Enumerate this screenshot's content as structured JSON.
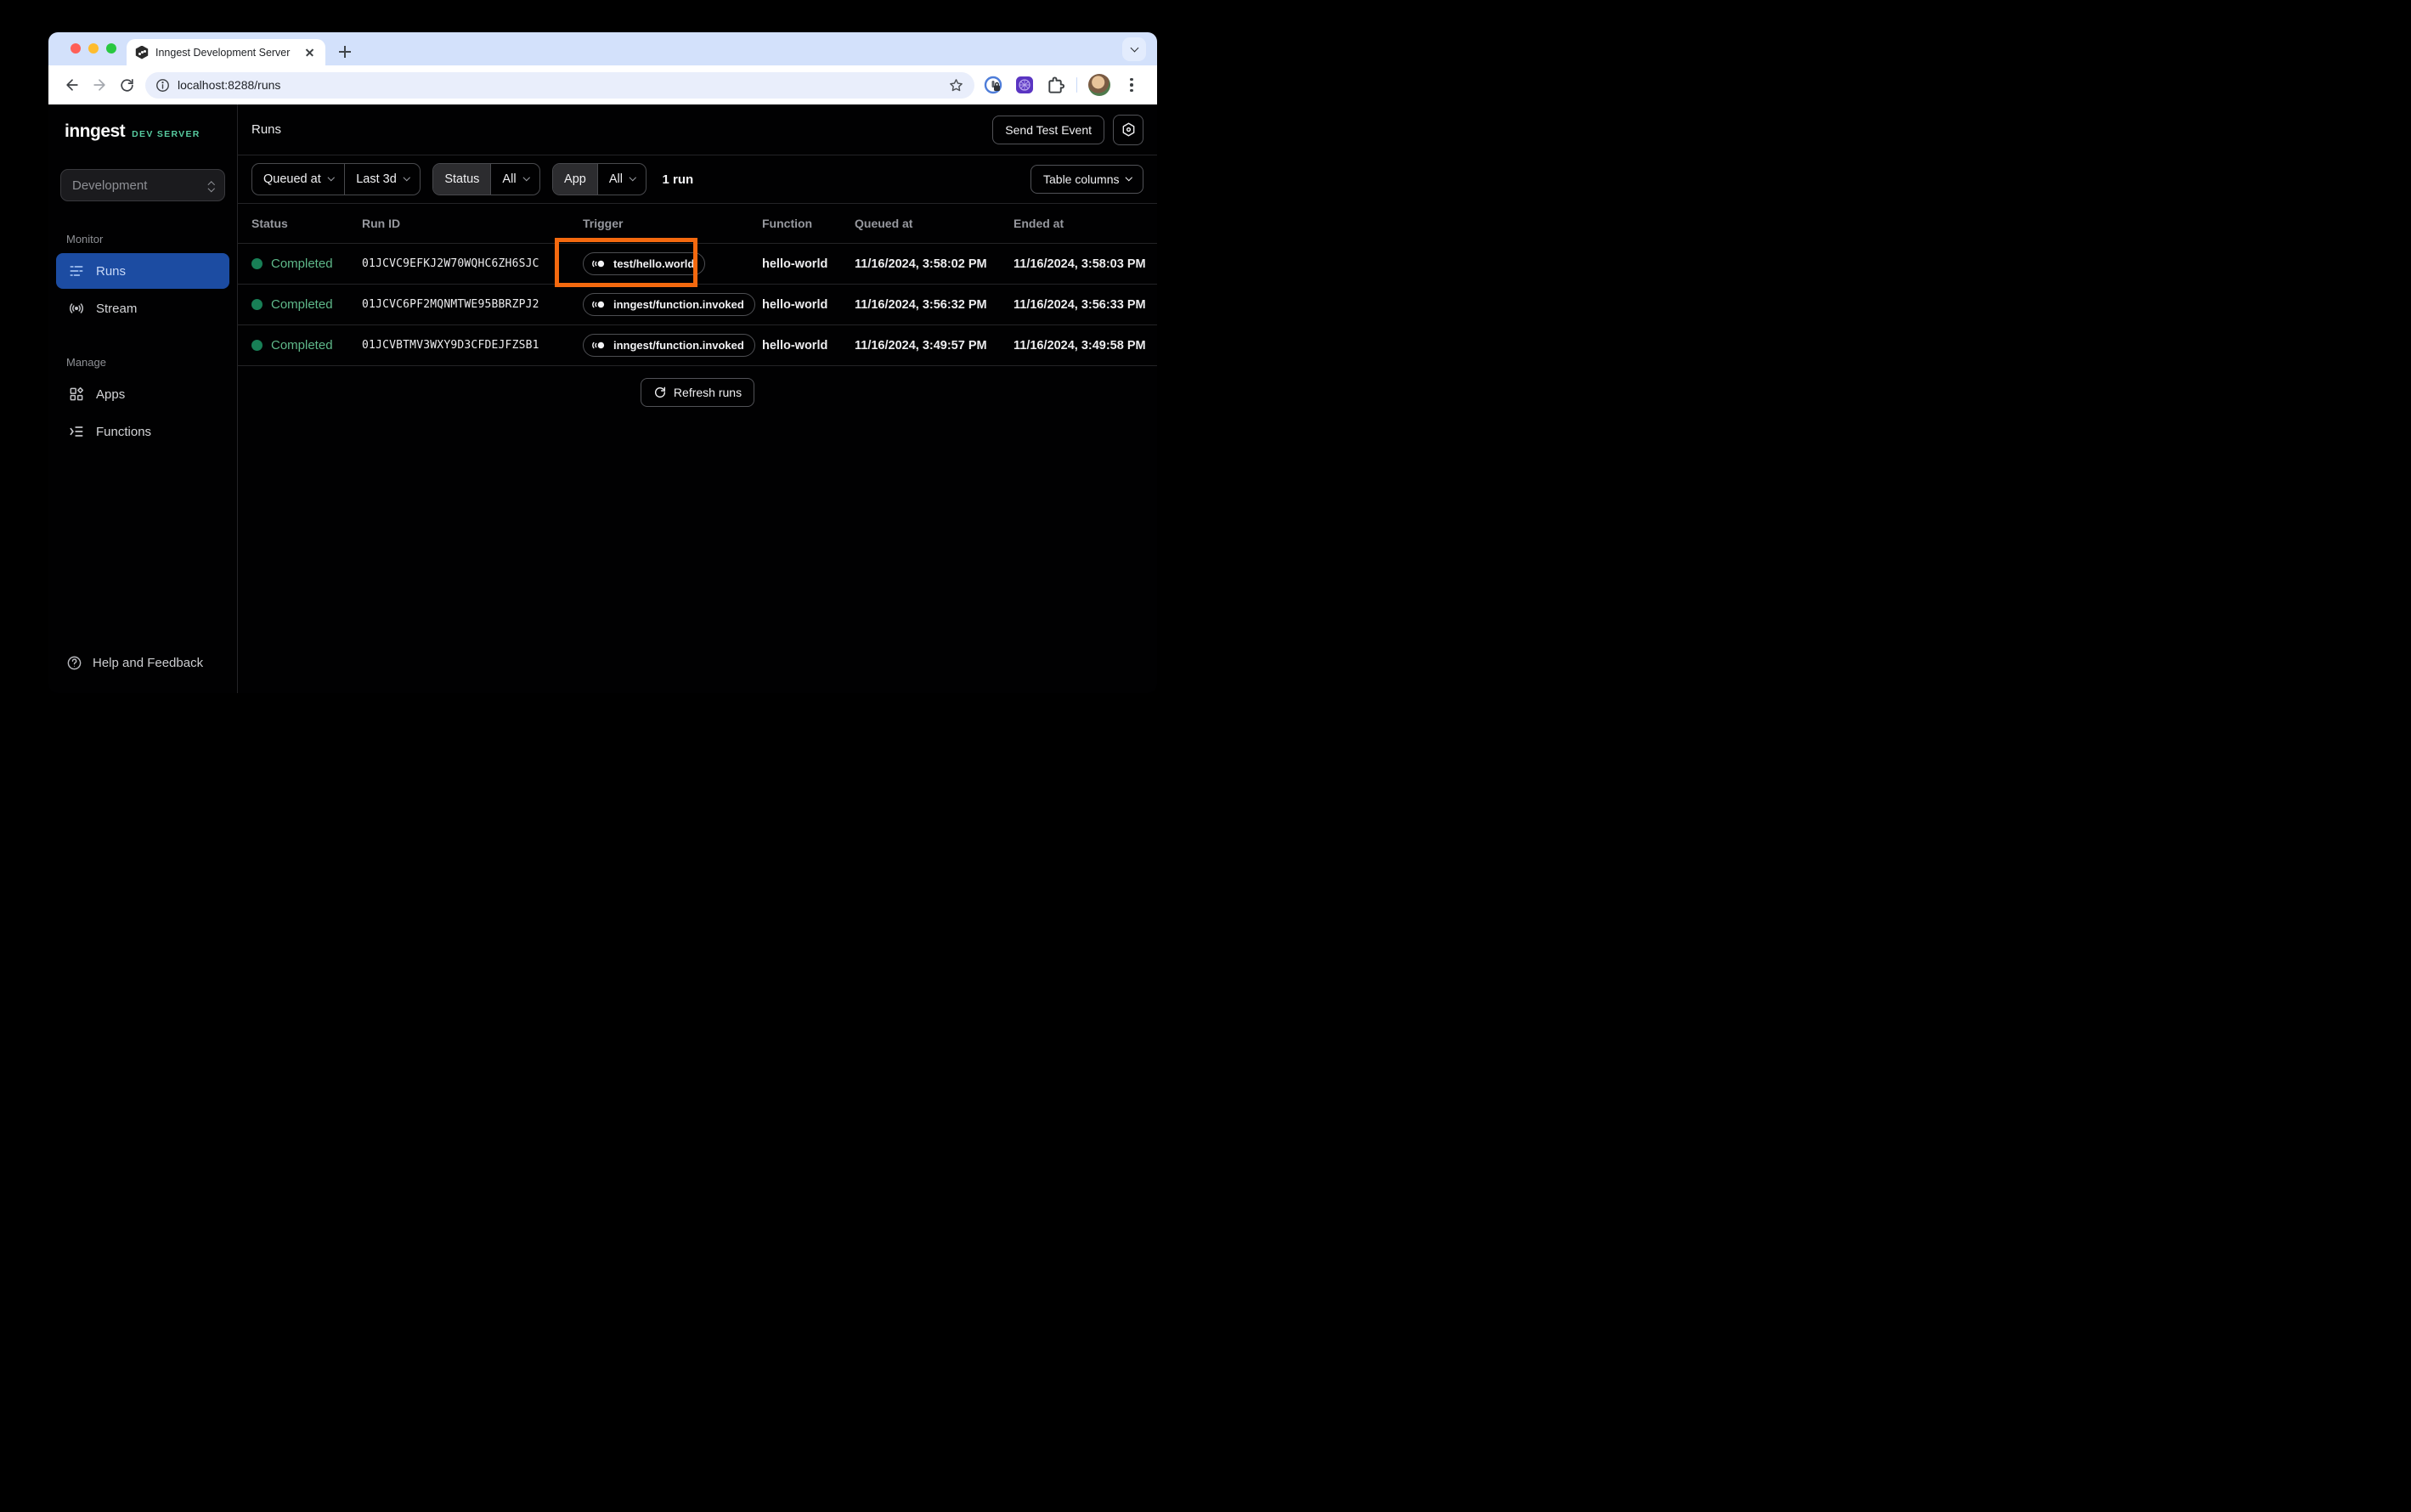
{
  "browser": {
    "tab_title": "Inngest Development Server",
    "url": "localhost:8288/runs"
  },
  "sidebar": {
    "logo": "inngest",
    "logo_suffix": "DEV SERVER",
    "environment": "Development",
    "sections": [
      {
        "label": "Monitor",
        "items": [
          {
            "label": "Runs"
          },
          {
            "label": "Stream"
          }
        ]
      },
      {
        "label": "Manage",
        "items": [
          {
            "label": "Apps"
          },
          {
            "label": "Functions"
          }
        ]
      }
    ],
    "footer": {
      "label": "Help and Feedback"
    }
  },
  "header": {
    "title": "Runs",
    "send_test_event_label": "Send Test Event"
  },
  "filters": {
    "queued_at_label": "Queued at",
    "time_range_value": "Last 3d",
    "status_label": "Status",
    "status_value": "All",
    "app_label": "App",
    "app_value": "All",
    "result_count": "1 run",
    "table_columns_label": "Table columns"
  },
  "table": {
    "columns": [
      "Status",
      "Run ID",
      "Trigger",
      "Function",
      "Queued at",
      "Ended at"
    ],
    "rows": [
      {
        "status": "Completed",
        "run_id": "01JCVC9EFKJ2W70WQHC6ZH6SJC",
        "trigger": "test/hello.world",
        "function": "hello-world",
        "queued_at": "11/16/2024, 3:58:02 PM",
        "ended_at": "11/16/2024, 3:58:03 PM"
      },
      {
        "status": "Completed",
        "run_id": "01JCVC6PF2MQNMTWE95BBRZPJ2",
        "trigger": "inngest/function.invoked",
        "function": "hello-world",
        "queued_at": "11/16/2024, 3:56:32 PM",
        "ended_at": "11/16/2024, 3:56:33 PM"
      },
      {
        "status": "Completed",
        "run_id": "01JCVBTMV3WXY9D3CFDEJFZSB1",
        "trigger": "inngest/function.invoked",
        "function": "hello-world",
        "queued_at": "11/16/2024, 3:49:57 PM",
        "ended_at": "11/16/2024, 3:49:58 PM"
      }
    ],
    "refresh_label": "Refresh runs"
  },
  "colors": {
    "active_nav_blue": "#1C4CA2",
    "status_green_dot": "#187F56",
    "status_green_text": "#5FB98A",
    "dev_server_green": "#57CBA0",
    "highlight_orange": "#F4690F",
    "tab_strip_blue": "#D3E1FB"
  }
}
